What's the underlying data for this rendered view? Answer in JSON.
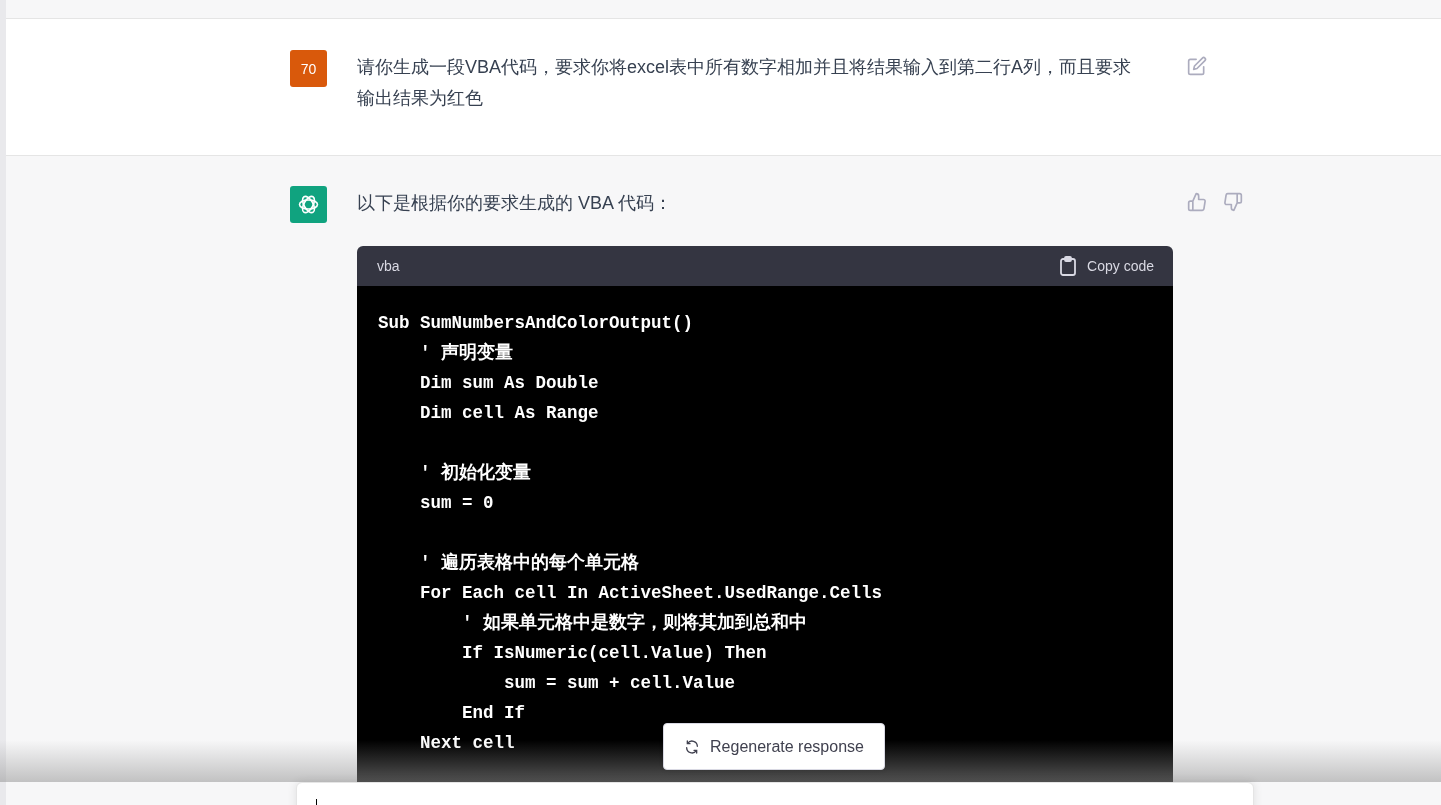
{
  "messages": [
    {
      "kind": "user",
      "avatar": "70",
      "text": "请你生成一段VBA代码，要求你将excel表中所有数字相加并且将结果输入到第二行A列，而且要求输出结果为红色"
    },
    {
      "kind": "assistant",
      "text": "以下是根据你的要求生成的 VBA 代码：",
      "code": {
        "language": "vba",
        "copy_label": "Copy code",
        "text": "Sub SumNumbersAndColorOutput()\n    ' 声明变量\n    Dim sum As Double\n    Dim cell As Range\n\n    ' 初始化变量\n    sum = 0\n\n    ' 遍历表格中的每个单元格\n    For Each cell In ActiveSheet.UsedRange.Cells\n        ' 如果单元格中是数字，则将其加到总和中\n        If IsNumeric(cell.Value) Then\n            sum = sum + cell.Value\n        End If\n    Next cell"
      }
    }
  ],
  "regenerate_button": "Regenerate response"
}
